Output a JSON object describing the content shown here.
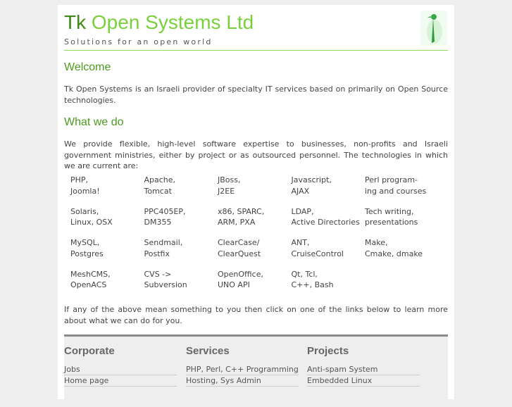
{
  "header": {
    "title_prefix": "Tk",
    "title_rest": "Open Systems Ltd",
    "tagline": "Solutions for an open world"
  },
  "welcome": {
    "heading": "Welcome",
    "text": "Tk Open Systems is an Israeli provider of specialty IT services based on primarily on Open Source technologies."
  },
  "whatwedo": {
    "heading": "What we do",
    "text": "We provide flexible, high-level software expertise to businesses, non-profits and Israeli government ministries, either by project or as outsourced personnel. The technologies in which we are current are:",
    "tech": [
      [
        "PHP,",
        "Joomla!"
      ],
      [
        "Apache,",
        "Tomcat"
      ],
      [
        "JBoss,",
        "J2EE"
      ],
      [
        "Javascript,",
        "AJAX"
      ],
      [
        "Perl program-",
        "ing and courses"
      ],
      [
        "Solaris,",
        "Linux, OSX"
      ],
      [
        "PPC405EP,",
        "DM355"
      ],
      [
        "x86, SPARC,",
        "ARM, PXA"
      ],
      [
        "LDAP,",
        "Active Directories"
      ],
      [
        "Tech writing,",
        "presentations"
      ],
      [
        "MySQL,",
        "Postgres"
      ],
      [
        "Sendmail,",
        "Postfix"
      ],
      [
        "ClearCase/",
        "ClearQuest"
      ],
      [
        "ANT,",
        "CruiseControl"
      ],
      [
        "Make,",
        "Cmake, dmake"
      ],
      [
        "MeshCMS,",
        "OpenACS"
      ],
      [
        "CVS ->",
        "Subversion"
      ],
      [
        "OpenOffice,",
        "UNO API"
      ],
      [
        "Qt, Tcl,",
        "C++, Bash"
      ]
    ],
    "closing": "If any of the above mean something to you then click on one of the links below to learn more about what we can do for you."
  },
  "footer": {
    "columns": [
      {
        "heading": "Corporate",
        "links": [
          "Jobs",
          "Home page"
        ]
      },
      {
        "heading": "Services",
        "links": [
          "PHP, Perl, C++ Programming",
          "Hosting, Sys Admin"
        ]
      },
      {
        "heading": "Projects",
        "links": [
          "Anti-spam System",
          "Embedded Linux"
        ]
      }
    ]
  }
}
